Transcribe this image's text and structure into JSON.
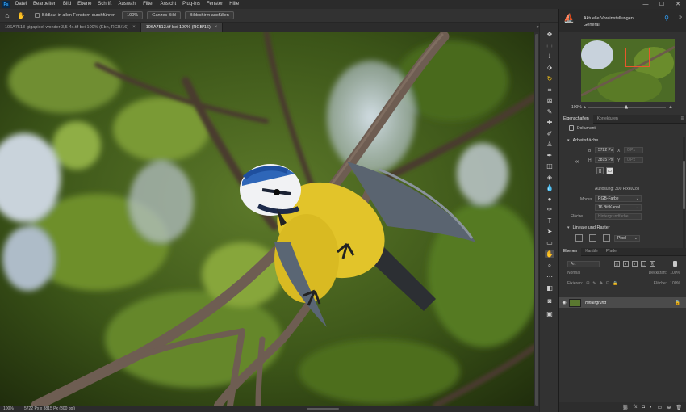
{
  "app": {
    "logo": "Ps"
  },
  "menu": {
    "items": [
      "Datei",
      "Bearbeiten",
      "Bild",
      "Ebene",
      "Schrift",
      "Auswahl",
      "Filter",
      "Ansicht",
      "Plug-ins",
      "Fenster",
      "Hilfe"
    ]
  },
  "window_controls": {
    "minimize": "—",
    "maximize": "☐",
    "close": "✕"
  },
  "options_bar": {
    "home_icon": "⌂",
    "hand_icon": "✋",
    "scroll_all_label": "Bildlauf in allen Fenstern durchführen",
    "zoom_100": "100%",
    "fit_label": "Ganzes Bild",
    "fill_label": "Bildschirm ausfüllen"
  },
  "tabs": [
    {
      "title": "106A7513-gigapixel-wonder 3,5-4x.tif bei 100% (Ebn, RGB/16)",
      "close": "×",
      "active": false
    },
    {
      "title": "106A7513.tif bei 100% (RGB/16)",
      "close": "×",
      "active": true
    }
  ],
  "tabs_more": "»",
  "status": {
    "zoom": "100%",
    "info": "5722 Px x 3815 Px (300 ppi)"
  },
  "learn": {
    "line1": "Aktuelle Voreinstellungen",
    "line2": "General"
  },
  "navigator": {
    "zoom_pct": "100%"
  },
  "properties": {
    "tab_active": "Eigenschaften",
    "tab_other": "Korrekturen",
    "doc_label": "Dokument",
    "canvas_section": "Arbeitsfläche",
    "width_label": "B",
    "width_value": "5722 Px",
    "height_label": "H",
    "height_value": "3815 Px",
    "x_label": "X",
    "x_value": "0 Px",
    "y_label": "Y",
    "y_value": "0 Px",
    "resolution": "Auflösung: 300 Pixel/Zoll",
    "mode_label": "Modus",
    "mode_value": "RGB-Farbe",
    "depth_value": "16 Bit/Kanal",
    "fill_label": "Fläche",
    "fill_value": "Hintergrundfarbe",
    "rulers_section": "Lineale und Raster",
    "units_value": "Pixel"
  },
  "layers_panel": {
    "tabs": [
      "Ebenen",
      "Kanäle",
      "Pfade"
    ],
    "search_placeholder": "Art",
    "blend_mode": "Normal",
    "opacity_label": "Deckkraft:",
    "opacity_value": "100%",
    "lock_label": "Fixieren:",
    "fill_label": "Fläche:",
    "fill_value": "100%",
    "layer_name": "Hintergrund"
  },
  "colors": {
    "accent": "#31a8ff",
    "highlight": "#f2c018",
    "nav_frame": "#e8582c"
  }
}
